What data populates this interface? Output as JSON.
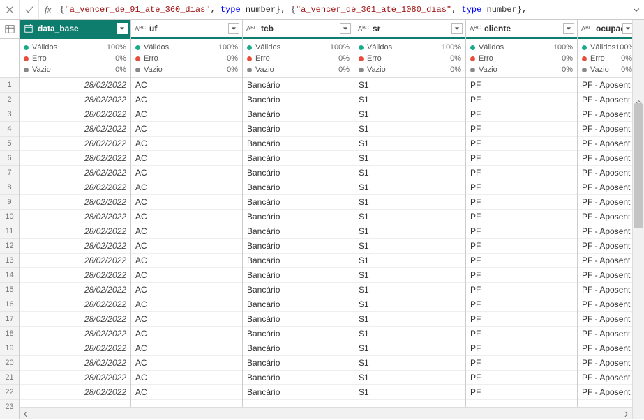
{
  "formula": {
    "prefix": "{",
    "str1": "\"a_vencer_de_91_ate_360_dias\"",
    "sep1": ", ",
    "kw1": "type",
    "sp1": " number}, {",
    "str2": "\"a_vencer_de_361_ate_1080_dias\"",
    "sep2": ", ",
    "kw2": "type",
    "sp2": " number},"
  },
  "fx_label": "fx",
  "quality": {
    "valid_label": "Válidos",
    "valid_pct": "100%",
    "error_label": "Erro",
    "error_pct": "0%",
    "empty_label": "Vazio",
    "empty_pct": "0%"
  },
  "columns": [
    {
      "name": "data_base",
      "type_icon": "date",
      "selected": true,
      "width": "w-date",
      "align": "date"
    },
    {
      "name": "uf",
      "type_icon": "abc",
      "selected": false,
      "width": "w-txt",
      "align": "text"
    },
    {
      "name": "tcb",
      "type_icon": "abc",
      "selected": false,
      "width": "w-txt",
      "align": "text"
    },
    {
      "name": "sr",
      "type_icon": "abc",
      "selected": false,
      "width": "w-txt",
      "align": "text"
    },
    {
      "name": "cliente",
      "type_icon": "abc",
      "selected": false,
      "width": "w-txt",
      "align": "text"
    },
    {
      "name": "ocupacao",
      "type_icon": "abc",
      "selected": false,
      "width": "w-last",
      "align": "text"
    }
  ],
  "row_count": 23,
  "data_rows": 22,
  "row_values": {
    "data_base": "28/02/2022",
    "uf": "AC",
    "tcb": "Bancário",
    "sr": "S1",
    "cliente": "PF",
    "ocupacao": "PF - Aposent"
  }
}
